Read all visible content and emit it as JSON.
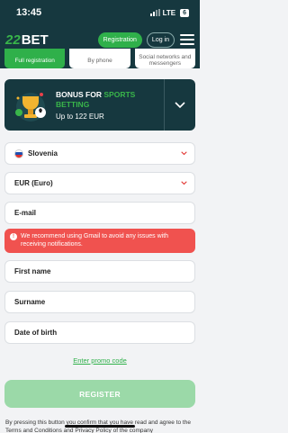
{
  "status": {
    "time": "13:45",
    "network": "LTE",
    "battery": "6"
  },
  "header": {
    "logo_num": "22",
    "logo_text": "BET",
    "register_label": "Registration",
    "login_label": "Log in"
  },
  "tabs": [
    {
      "label": "Full registration"
    },
    {
      "label": "By phone"
    },
    {
      "label": "Social networks and messengers"
    }
  ],
  "bonus": {
    "title_prefix": "BONUS FOR ",
    "title_highlight": "SPORTS BETTING",
    "subtitle": "Up to 122 EUR"
  },
  "form": {
    "country": "Slovenia",
    "currency": "EUR (Euro)",
    "email_placeholder": "E-mail",
    "alert": "We recommend using Gmail to avoid any issues with receiving notifications.",
    "first_name_placeholder": "First name",
    "surname_placeholder": "Surname",
    "dob_placeholder": "Date of birth",
    "promo_link": "Enter promo code",
    "register_label": "REGISTER",
    "terms": "By pressing this button you confirm that you have read and agree to the Terms and Conditions and Privacy Policy of the company"
  },
  "colors": {
    "brand_dark": "#16383f",
    "accent_green": "#2fb04a",
    "alert_red": "#f0524f",
    "disabled_green": "#9bd9a8"
  },
  "icons": [
    "signal-icon",
    "battery-icon",
    "menu-icon",
    "chevron-down-icon",
    "info-icon",
    "flag-slovenia-icon"
  ]
}
